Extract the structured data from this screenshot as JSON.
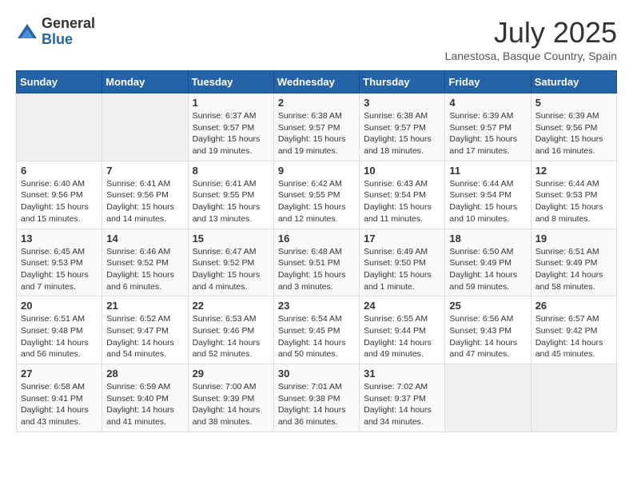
{
  "logo": {
    "general": "General",
    "blue": "Blue"
  },
  "title": {
    "month": "July 2025",
    "location": "Lanestosa, Basque Country, Spain"
  },
  "headers": [
    "Sunday",
    "Monday",
    "Tuesday",
    "Wednesday",
    "Thursday",
    "Friday",
    "Saturday"
  ],
  "weeks": [
    [
      {
        "day": "",
        "info": ""
      },
      {
        "day": "",
        "info": ""
      },
      {
        "day": "1",
        "info": "Sunrise: 6:37 AM\nSunset: 9:57 PM\nDaylight: 15 hours and 19 minutes."
      },
      {
        "day": "2",
        "info": "Sunrise: 6:38 AM\nSunset: 9:57 PM\nDaylight: 15 hours and 19 minutes."
      },
      {
        "day": "3",
        "info": "Sunrise: 6:38 AM\nSunset: 9:57 PM\nDaylight: 15 hours and 18 minutes."
      },
      {
        "day": "4",
        "info": "Sunrise: 6:39 AM\nSunset: 9:57 PM\nDaylight: 15 hours and 17 minutes."
      },
      {
        "day": "5",
        "info": "Sunrise: 6:39 AM\nSunset: 9:56 PM\nDaylight: 15 hours and 16 minutes."
      }
    ],
    [
      {
        "day": "6",
        "info": "Sunrise: 6:40 AM\nSunset: 9:56 PM\nDaylight: 15 hours and 15 minutes."
      },
      {
        "day": "7",
        "info": "Sunrise: 6:41 AM\nSunset: 9:56 PM\nDaylight: 15 hours and 14 minutes."
      },
      {
        "day": "8",
        "info": "Sunrise: 6:41 AM\nSunset: 9:55 PM\nDaylight: 15 hours and 13 minutes."
      },
      {
        "day": "9",
        "info": "Sunrise: 6:42 AM\nSunset: 9:55 PM\nDaylight: 15 hours and 12 minutes."
      },
      {
        "day": "10",
        "info": "Sunrise: 6:43 AM\nSunset: 9:54 PM\nDaylight: 15 hours and 11 minutes."
      },
      {
        "day": "11",
        "info": "Sunrise: 6:44 AM\nSunset: 9:54 PM\nDaylight: 15 hours and 10 minutes."
      },
      {
        "day": "12",
        "info": "Sunrise: 6:44 AM\nSunset: 9:53 PM\nDaylight: 15 hours and 8 minutes."
      }
    ],
    [
      {
        "day": "13",
        "info": "Sunrise: 6:45 AM\nSunset: 9:53 PM\nDaylight: 15 hours and 7 minutes."
      },
      {
        "day": "14",
        "info": "Sunrise: 6:46 AM\nSunset: 9:52 PM\nDaylight: 15 hours and 6 minutes."
      },
      {
        "day": "15",
        "info": "Sunrise: 6:47 AM\nSunset: 9:52 PM\nDaylight: 15 hours and 4 minutes."
      },
      {
        "day": "16",
        "info": "Sunrise: 6:48 AM\nSunset: 9:51 PM\nDaylight: 15 hours and 3 minutes."
      },
      {
        "day": "17",
        "info": "Sunrise: 6:49 AM\nSunset: 9:50 PM\nDaylight: 15 hours and 1 minute."
      },
      {
        "day": "18",
        "info": "Sunrise: 6:50 AM\nSunset: 9:49 PM\nDaylight: 14 hours and 59 minutes."
      },
      {
        "day": "19",
        "info": "Sunrise: 6:51 AM\nSunset: 9:49 PM\nDaylight: 14 hours and 58 minutes."
      }
    ],
    [
      {
        "day": "20",
        "info": "Sunrise: 6:51 AM\nSunset: 9:48 PM\nDaylight: 14 hours and 56 minutes."
      },
      {
        "day": "21",
        "info": "Sunrise: 6:52 AM\nSunset: 9:47 PM\nDaylight: 14 hours and 54 minutes."
      },
      {
        "day": "22",
        "info": "Sunrise: 6:53 AM\nSunset: 9:46 PM\nDaylight: 14 hours and 52 minutes."
      },
      {
        "day": "23",
        "info": "Sunrise: 6:54 AM\nSunset: 9:45 PM\nDaylight: 14 hours and 50 minutes."
      },
      {
        "day": "24",
        "info": "Sunrise: 6:55 AM\nSunset: 9:44 PM\nDaylight: 14 hours and 49 minutes."
      },
      {
        "day": "25",
        "info": "Sunrise: 6:56 AM\nSunset: 9:43 PM\nDaylight: 14 hours and 47 minutes."
      },
      {
        "day": "26",
        "info": "Sunrise: 6:57 AM\nSunset: 9:42 PM\nDaylight: 14 hours and 45 minutes."
      }
    ],
    [
      {
        "day": "27",
        "info": "Sunrise: 6:58 AM\nSunset: 9:41 PM\nDaylight: 14 hours and 43 minutes."
      },
      {
        "day": "28",
        "info": "Sunrise: 6:59 AM\nSunset: 9:40 PM\nDaylight: 14 hours and 41 minutes."
      },
      {
        "day": "29",
        "info": "Sunrise: 7:00 AM\nSunset: 9:39 PM\nDaylight: 14 hours and 38 minutes."
      },
      {
        "day": "30",
        "info": "Sunrise: 7:01 AM\nSunset: 9:38 PM\nDaylight: 14 hours and 36 minutes."
      },
      {
        "day": "31",
        "info": "Sunrise: 7:02 AM\nSunset: 9:37 PM\nDaylight: 14 hours and 34 minutes."
      },
      {
        "day": "",
        "info": ""
      },
      {
        "day": "",
        "info": ""
      }
    ]
  ]
}
